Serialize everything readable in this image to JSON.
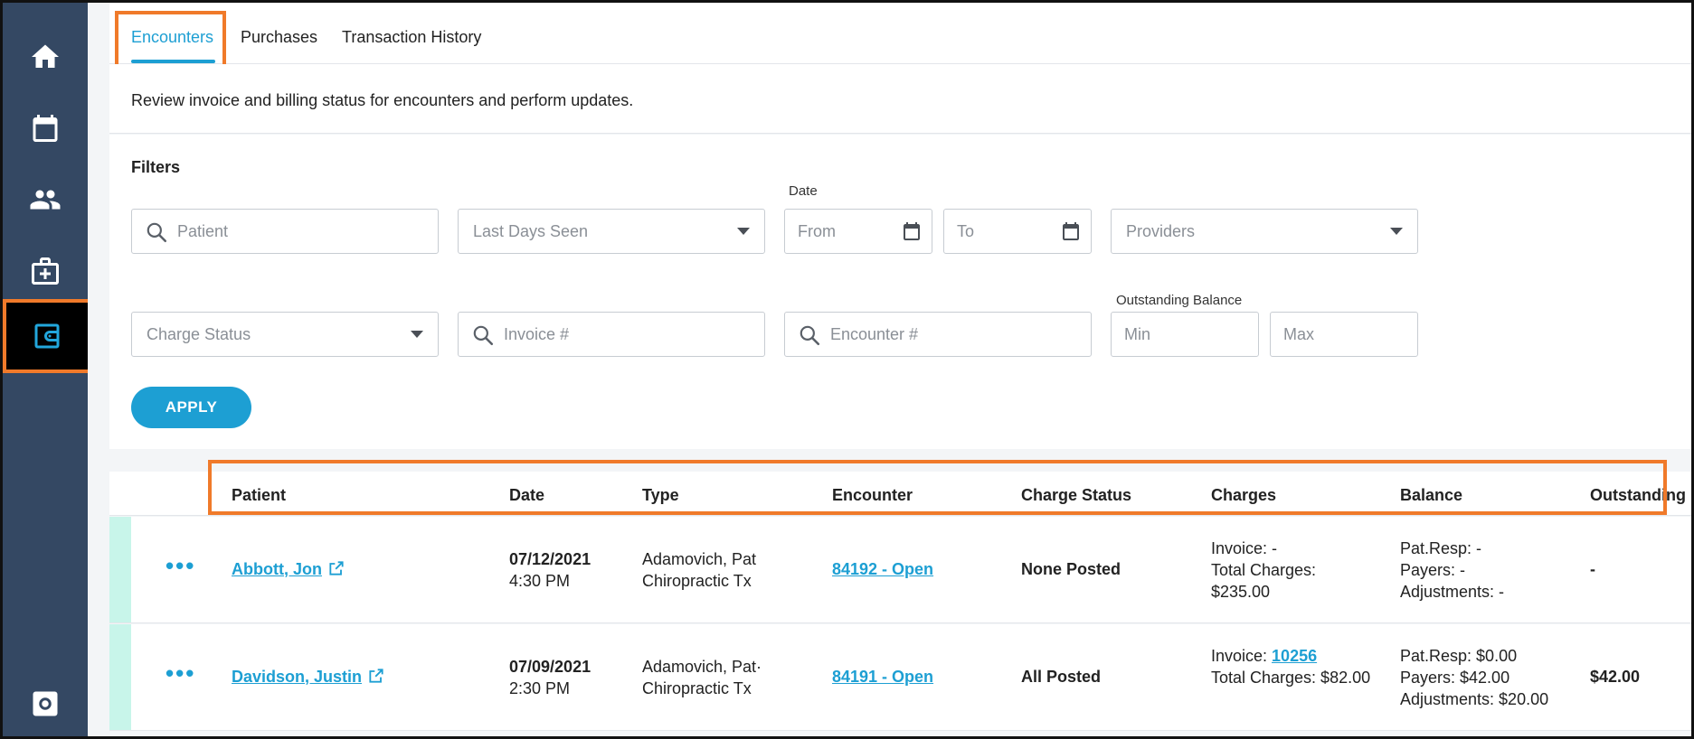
{
  "sidebar": {
    "items": [
      {
        "icon": "home-icon"
      },
      {
        "icon": "calendar-icon"
      },
      {
        "icon": "people-icon"
      },
      {
        "icon": "medical-kit-icon"
      },
      {
        "icon": "wallet-icon",
        "active": true
      },
      {
        "icon": "gear-icon"
      }
    ]
  },
  "tabs": {
    "encounters": "Encounters",
    "purchases": "Purchases",
    "transaction_history": "Transaction History"
  },
  "description": "Review invoice and billing status for encounters and perform updates.",
  "filters": {
    "title": "Filters",
    "patient_placeholder": "Patient",
    "last_days_seen": "Last Days Seen",
    "date_label": "Date",
    "from_placeholder": "From",
    "to_placeholder": "To",
    "providers": "Providers",
    "charge_status": "Charge Status",
    "invoice_placeholder": "Invoice #",
    "encounter_placeholder": "Encounter #",
    "outstanding_label": "Outstanding Balance",
    "min_placeholder": "Min",
    "max_placeholder": "Max",
    "apply": "APPLY"
  },
  "table": {
    "headers": {
      "patient": "Patient",
      "date": "Date",
      "type": "Type",
      "encounter": "Encounter",
      "charge_status": "Charge Status",
      "charges": "Charges",
      "balance": "Balance",
      "outstanding": "Outstanding"
    },
    "rows": [
      {
        "patient": "Abbott, Jon",
        "date": "07/12/2021",
        "time": "4:30 PM",
        "type_line1": "Adamovich, Pat",
        "type_line2": "Chiropractic Tx",
        "encounter": "84192 - Open",
        "charge_status": "None Posted",
        "invoice_prefix": "Invoice: -",
        "invoice_link": "",
        "total_charges_a": "Total Charges:",
        "total_charges_b": "$235.00",
        "pat_resp": "Pat.Resp: -",
        "payers": "Payers: -",
        "adjustments": "Adjustments: -",
        "outstanding": "-"
      },
      {
        "patient": "Davidson, Justin",
        "date": "07/09/2021",
        "time": "2:30 PM",
        "type_line1": "Adamovich, Pat·",
        "type_line2": "Chiropractic Tx",
        "encounter": "84191 - Open",
        "charge_status": "All Posted",
        "invoice_prefix": "Invoice: ",
        "invoice_link": "10256",
        "total_charges_a": "Total Charges: $82.00",
        "total_charges_b": "",
        "pat_resp": "Pat.Resp: $0.00",
        "payers": "Payers: $42.00",
        "adjustments": "Adjustments: $20.00",
        "outstanding": "$42.00"
      }
    ]
  },
  "colors": {
    "sidebar": "#344863",
    "accent": "#1d9fd3",
    "highlight": "#f07a2a",
    "row_stripe": "#c8f5ea"
  }
}
